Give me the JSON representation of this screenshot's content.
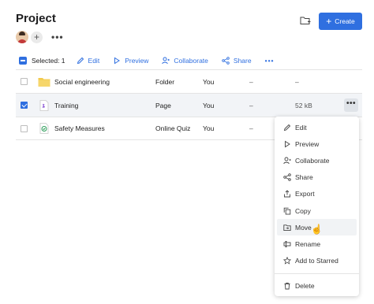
{
  "page": {
    "title": "Project"
  },
  "header": {
    "create_label": "Create"
  },
  "toolbar": {
    "selected_label": "Selected: 1",
    "actions": [
      "Edit",
      "Preview",
      "Collaborate",
      "Share"
    ]
  },
  "files": [
    {
      "name": "Social engineering",
      "type": "Folder",
      "owner": "You",
      "modified": "–",
      "size": "–",
      "icon": "folder-icon",
      "checked": false
    },
    {
      "name": "Training",
      "type": "Page",
      "owner": "You",
      "modified": "–",
      "size": "52 kB",
      "icon": "page-icon",
      "checked": true
    },
    {
      "name": "Safety Measures",
      "type": "Online Quiz",
      "owner": "You",
      "modified": "–",
      "size": "",
      "icon": "quiz-icon",
      "checked": false
    }
  ],
  "context_menu": {
    "items": [
      "Edit",
      "Preview",
      "Collaborate",
      "Share",
      "Export",
      "Copy",
      "Move",
      "Rename",
      "Add to Starred"
    ],
    "delete_label": "Delete",
    "hovered": "Move"
  },
  "colors": {
    "accent": "#2f6fe0",
    "selected_row": "#f2f4f7",
    "quiz_green": "#2e9e5b",
    "folder_yellow": "#f2c94c",
    "page_purple": "#8e5bd6"
  }
}
